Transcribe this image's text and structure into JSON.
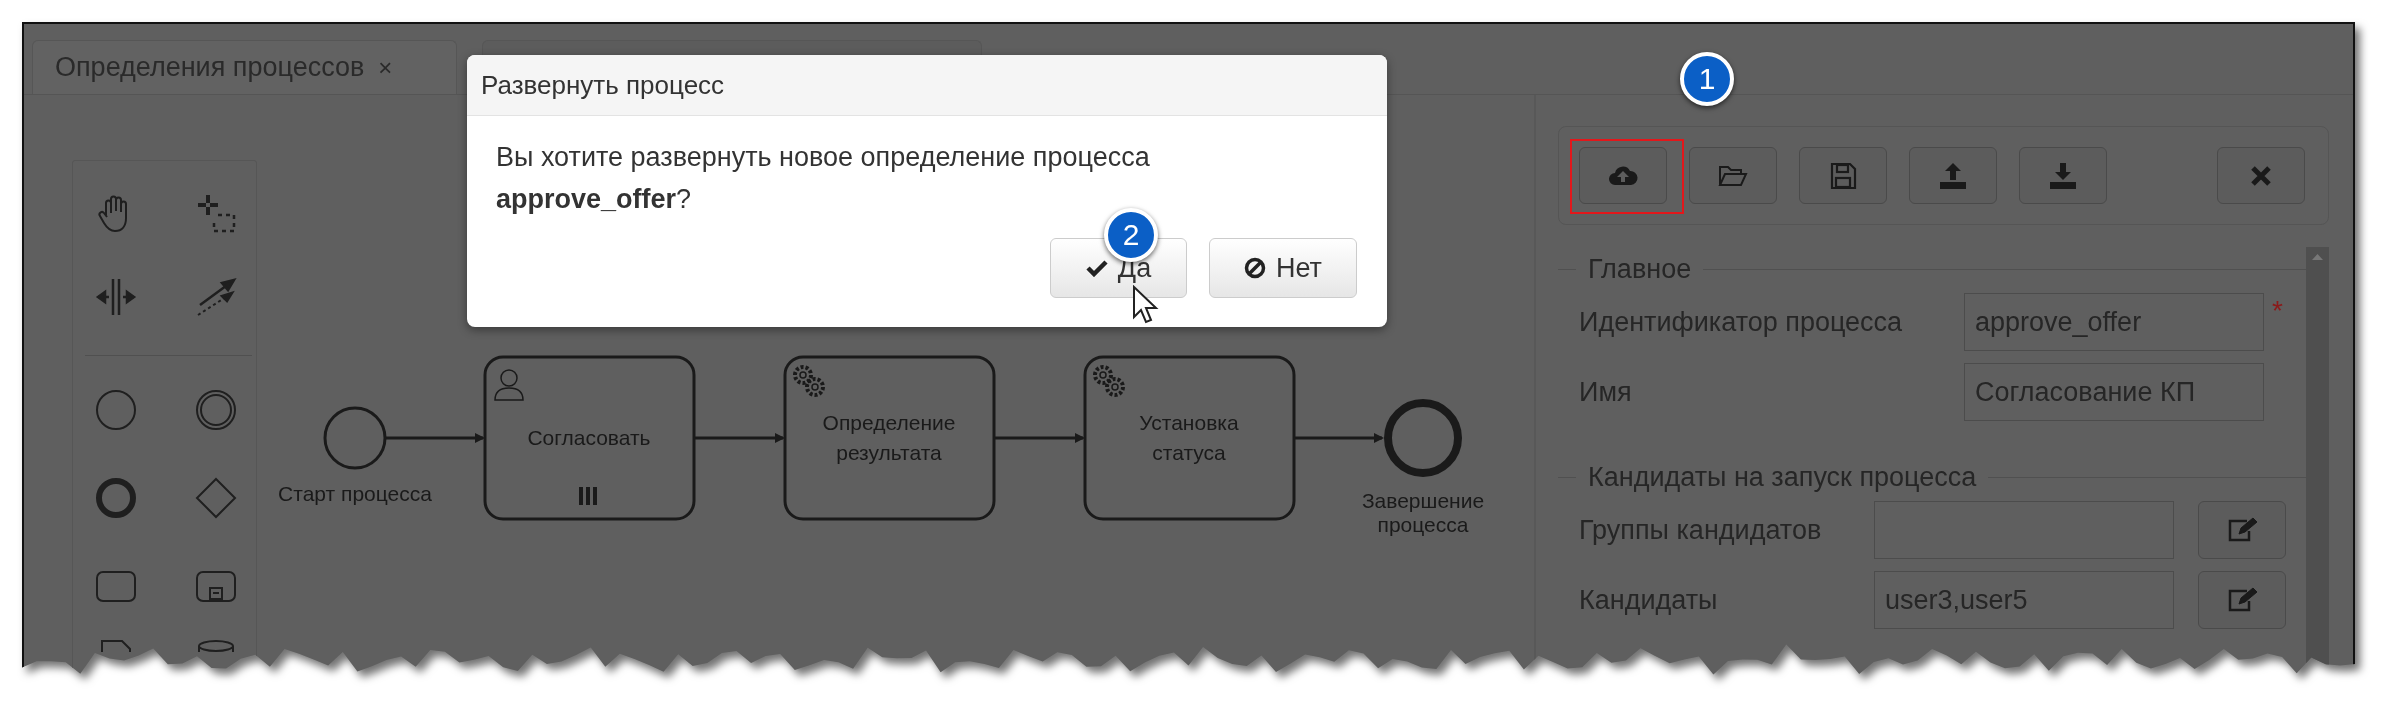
{
  "tabs": [
    {
      "label": "Определения процессов",
      "close": "×",
      "selected": true
    },
    {
      "selected": false
    }
  ],
  "palette": [
    {
      "kind": "hand"
    },
    {
      "kind": "lasso"
    },
    {
      "kind": "space"
    },
    {
      "kind": "connect"
    },
    {
      "kind": "start-event"
    },
    {
      "kind": "intermediate-event"
    },
    {
      "kind": "end-event"
    },
    {
      "kind": "gateway"
    },
    {
      "kind": "task"
    },
    {
      "kind": "subprocess"
    },
    {
      "kind": "data-object"
    },
    {
      "kind": "data-store"
    }
  ],
  "diagram": {
    "nodes": [
      {
        "kind": "start",
        "label": "Старт процесса"
      },
      {
        "kind": "user-task",
        "label": "Согласовать",
        "multi_instance": true
      },
      {
        "kind": "service-task",
        "label": "Определение результата",
        "multi_instance": false
      },
      {
        "kind": "service-task",
        "label": "Установка статуса",
        "multi_instance": false
      },
      {
        "kind": "end",
        "label": "Завершение процесса"
      }
    ]
  },
  "toolbar": {
    "callout": "1",
    "buttons": [
      {
        "kind": "deploy",
        "highlighted": true
      },
      {
        "kind": "open",
        "highlighted": false
      },
      {
        "kind": "save",
        "highlighted": false
      },
      {
        "kind": "upload",
        "highlighted": false
      },
      {
        "kind": "download",
        "highlighted": false
      },
      {
        "kind": "close",
        "highlighted": false
      }
    ]
  },
  "form": {
    "sections": [
      {
        "title": "Главное",
        "fields": [
          {
            "label": "Идентификатор процесса",
            "value": "approve_offer",
            "marker": "*",
            "edit_button": false
          },
          {
            "label": "Имя",
            "value": "Согласование КП",
            "edit_button": false
          }
        ]
      },
      {
        "title": "Кандидаты на запуск процесса",
        "fields": [
          {
            "label": "Группы кандидатов",
            "edit_button": true
          },
          {
            "label": "Кандидаты",
            "value": "user3,user5",
            "edit_button": true
          }
        ]
      }
    ]
  },
  "modal": {
    "title": "Развернуть процесс",
    "message": "Вы хотите развернуть новое определение процесса **approve_offer**?",
    "callout": "2",
    "buttons": [
      {
        "kind": "confirm",
        "label": "Да"
      },
      {
        "kind": "cancel",
        "label": "Нет"
      }
    ]
  }
}
